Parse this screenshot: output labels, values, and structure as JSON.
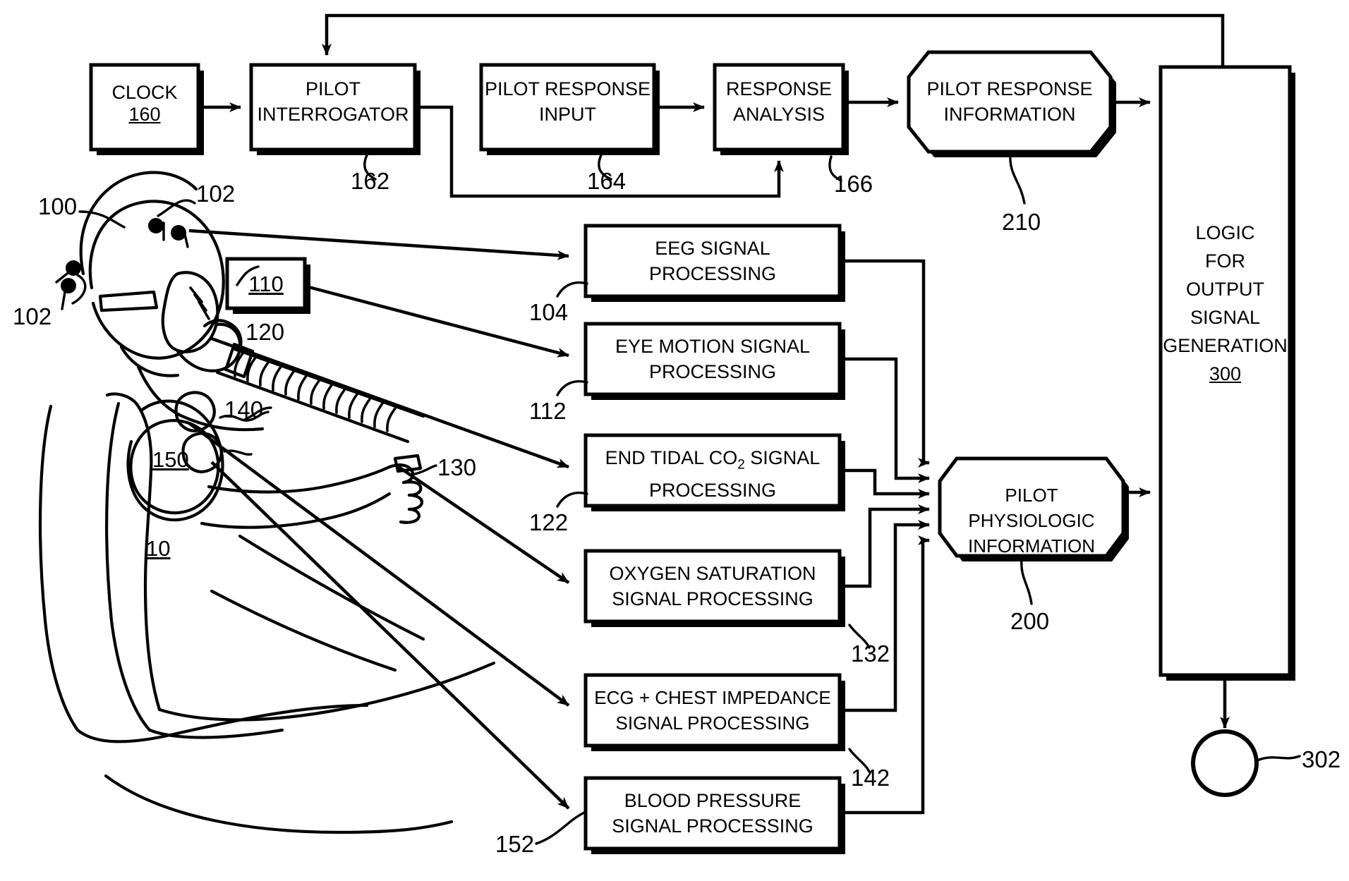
{
  "figure": {
    "title": "Pilot physiologic and response monitoring block diagram",
    "line_color": "#000000",
    "background_color": "#ffffff"
  },
  "blocks": {
    "clock": {
      "label_line1": "CLOCK",
      "ref": "160",
      "shape": "rect"
    },
    "pilot_interrogator": {
      "label_line1": "PILOT",
      "label_line2": "INTERROGATOR",
      "ref": "162",
      "shape": "rect"
    },
    "pilot_response_input": {
      "label_line1": "PILOT RESPONSE",
      "label_line2": "INPUT",
      "ref": "164",
      "shape": "rect"
    },
    "response_analysis": {
      "label_line1": "RESPONSE",
      "label_line2": "ANALYSIS",
      "ref": "166",
      "shape": "rect"
    },
    "pilot_response_information": {
      "label_line1": "PILOT RESPONSE",
      "label_line2": "INFORMATION",
      "ref": "210",
      "shape": "octagon"
    },
    "logic_output": {
      "label_lines": [
        "LOGIC",
        "FOR",
        "OUTPUT",
        "SIGNAL",
        "GENERATION"
      ],
      "ref": "300",
      "shape": "rect-tall"
    },
    "eeg": {
      "label_line1": "EEG SIGNAL",
      "label_line2": "PROCESSING",
      "ref": "104",
      "shape": "rect"
    },
    "eye_motion": {
      "label_line1": "EYE MOTION SIGNAL",
      "label_line2": "PROCESSING",
      "ref": "112",
      "shape": "rect"
    },
    "end_tidal_co2": {
      "label_pre": "END TIDAL CO",
      "label_sub": "2",
      "label_post": " SIGNAL",
      "label_line2": "PROCESSING",
      "ref": "122",
      "shape": "rect"
    },
    "oxygen_saturation": {
      "label_line1": "OXYGEN SATURATION",
      "label_line2": "SIGNAL PROCESSING",
      "ref": "132",
      "shape": "rect"
    },
    "ecg_chest_impedance": {
      "label_line1": "ECG + CHEST IMPEDANCE",
      "label_line2": "SIGNAL PROCESSING",
      "ref": "142",
      "shape": "rect"
    },
    "blood_pressure": {
      "label_line1": "BLOOD PRESSURE",
      "label_line2": "SIGNAL PROCESSING",
      "ref": "152",
      "shape": "rect"
    },
    "pilot_physiologic_information": {
      "label_line1": "PILOT PHYSIOLOGIC",
      "label_line2": "INFORMATION",
      "ref": "200",
      "shape": "octagon"
    },
    "output_node": {
      "ref": "302",
      "shape": "circle"
    },
    "sensor_box_110": {
      "ref": "110",
      "shape": "rect-small"
    }
  },
  "pilot_illustration": {
    "ref_pilot": "100",
    "ref_electrodes": "102",
    "ref_electrodes_alt": "102",
    "ref_eye_sensor": "110",
    "ref_mask_hose": "120",
    "ref_chest": "140",
    "ref_arm_cuff": "150",
    "ref_seat": "10",
    "ref_finger_sensor": "130"
  },
  "reference_numerals": [
    "100",
    "102",
    "110",
    "120",
    "130",
    "140",
    "150",
    "10",
    "104",
    "112",
    "122",
    "132",
    "142",
    "152",
    "160",
    "162",
    "164",
    "166",
    "200",
    "210",
    "300",
    "302"
  ]
}
